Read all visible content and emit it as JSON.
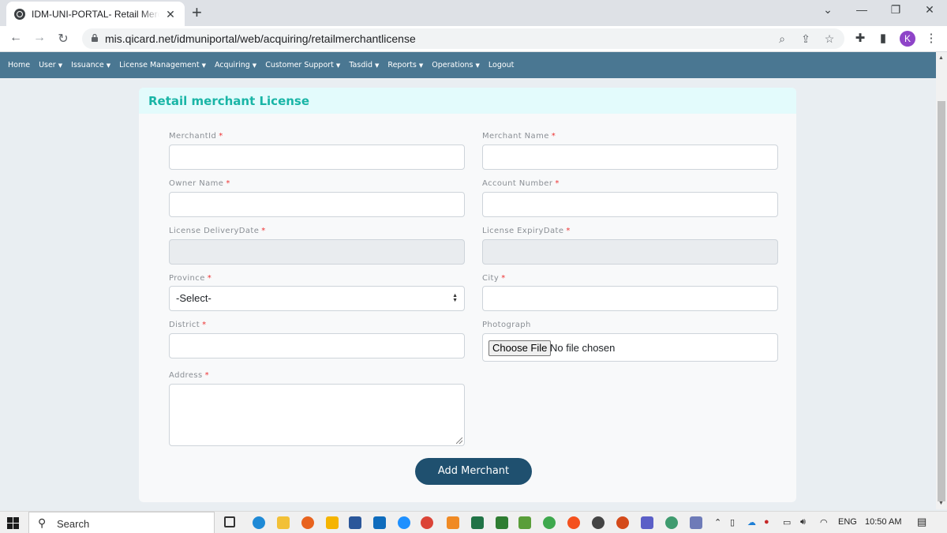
{
  "browser": {
    "tab_title": "IDM-UNI-PORTAL- Retail Merchant License",
    "url": "mis.qicard.net/idmuniportal/web/acquiring/retailmerchantlicense",
    "profile_initial": "K"
  },
  "nav": {
    "items": [
      {
        "label": "Home",
        "dropdown": false
      },
      {
        "label": "User",
        "dropdown": true
      },
      {
        "label": "Issuance",
        "dropdown": true
      },
      {
        "label": "License Management",
        "dropdown": true
      },
      {
        "label": "Acquiring",
        "dropdown": true
      },
      {
        "label": "Customer Support",
        "dropdown": true
      },
      {
        "label": "Tasdid",
        "dropdown": true
      },
      {
        "label": "Reports",
        "dropdown": true
      },
      {
        "label": "Operations",
        "dropdown": true
      },
      {
        "label": "Logout",
        "dropdown": false
      }
    ]
  },
  "form": {
    "title": "Retail merchant License",
    "fields": {
      "merchant_id": {
        "label": "MerchantId",
        "value": ""
      },
      "merchant_name": {
        "label": "Merchant Name",
        "value": ""
      },
      "owner_name": {
        "label": "Owner Name",
        "value": ""
      },
      "account_number": {
        "label": "Account Number",
        "value": ""
      },
      "delivery_date": {
        "label": "License DeliveryDate",
        "value": ""
      },
      "expiry_date": {
        "label": "License ExpiryDate",
        "value": ""
      },
      "province": {
        "label": "Province",
        "selected": "-Select-"
      },
      "city": {
        "label": "City",
        "value": ""
      },
      "district": {
        "label": "District",
        "value": ""
      },
      "photograph": {
        "label": "Photograph",
        "button": "Choose File",
        "status": "No file chosen"
      },
      "address": {
        "label": "Address",
        "value": ""
      }
    },
    "required_mark": "*",
    "submit_label": "Add Merchant"
  },
  "taskbar": {
    "search_label": "Search",
    "language": "ENG",
    "time": "10:50 AM"
  },
  "colors": {
    "nav_bg": "#4a7792",
    "card_header_bg": "#e3fbfc",
    "title_color": "#19b5a6",
    "button_bg": "#1f506f",
    "required_color": "#e33333"
  }
}
